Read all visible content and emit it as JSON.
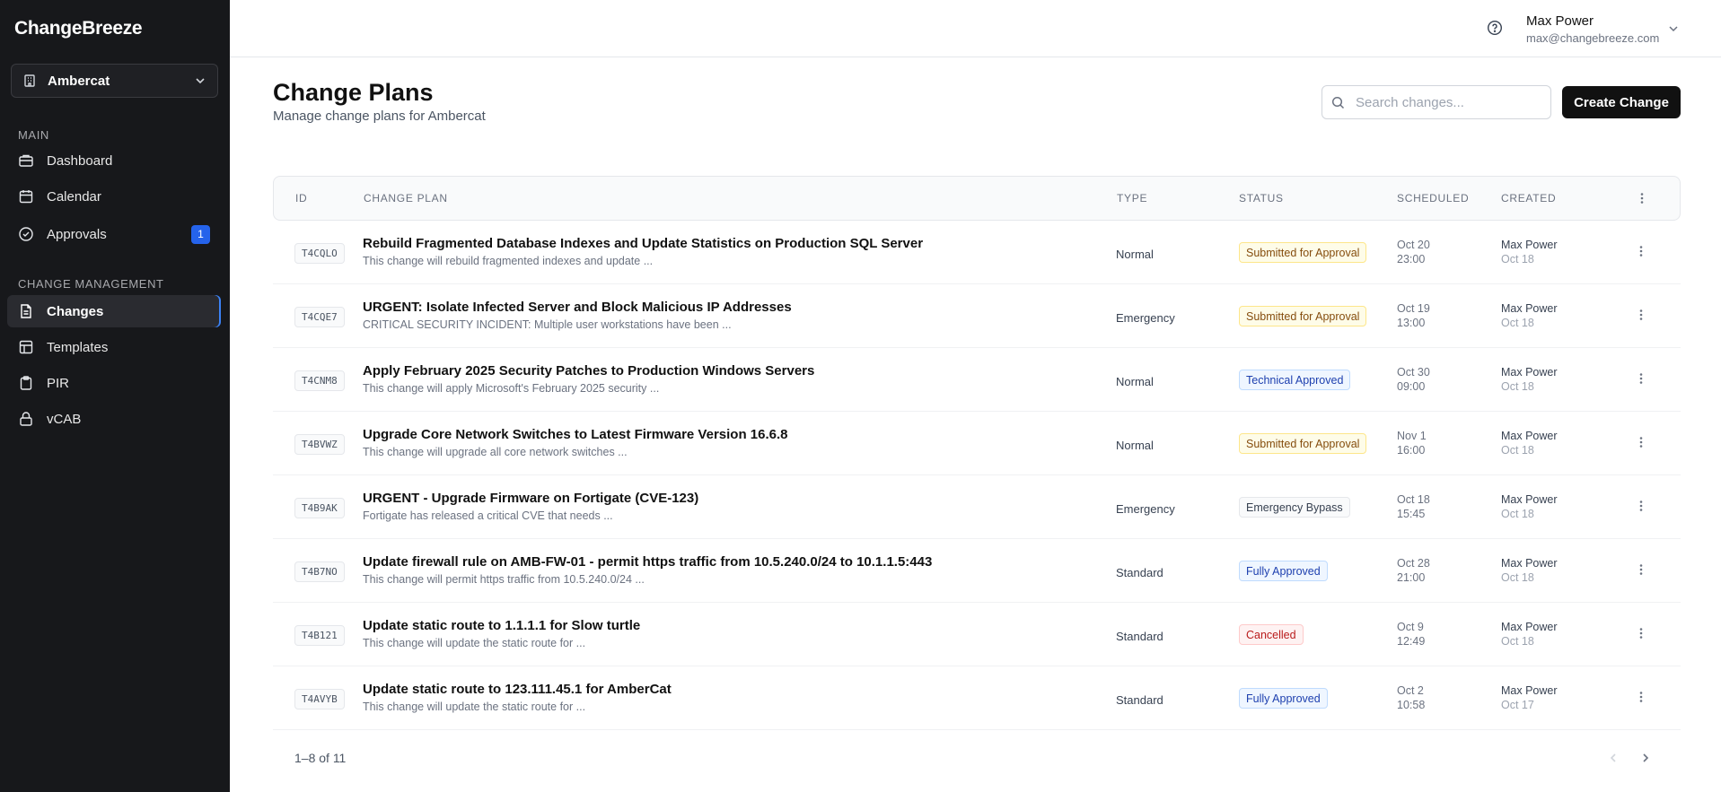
{
  "sidebar": {
    "brand": "ChangeBreeze",
    "org": "Ambercat",
    "sections": {
      "main": "MAIN",
      "change_management": "CHANGE MANAGEMENT"
    },
    "items": [
      {
        "label": "Dashboard",
        "icon": "briefcase-icon"
      },
      {
        "label": "Calendar",
        "icon": "calendar-icon"
      },
      {
        "label": "Approvals",
        "icon": "check-circle-icon",
        "badge": "1"
      },
      {
        "label": "Changes",
        "icon": "document-icon",
        "active": true
      },
      {
        "label": "Templates",
        "icon": "templates-icon"
      },
      {
        "label": "PIR",
        "icon": "clipboard-icon"
      },
      {
        "label": "vCAB",
        "icon": "lock-icon"
      }
    ]
  },
  "header": {
    "user_name": "Max Power",
    "user_email": "max@changebreeze.com"
  },
  "page": {
    "title": "Change Plans",
    "subtitle": "Manage change plans for Ambercat",
    "search_placeholder": "Search changes...",
    "create_label": "Create Change"
  },
  "table": {
    "headers": {
      "id": "ID",
      "plan": "CHANGE PLAN",
      "type": "TYPE",
      "status": "STATUS",
      "scheduled": "SCHEDULED",
      "created": "CREATED"
    },
    "rows": [
      {
        "id": "T4CQLO",
        "title": "Rebuild Fragmented Database Indexes and Update Statistics on Production SQL Server",
        "desc": "This change will rebuild fragmented indexes and update ...",
        "type": "Normal",
        "status": "Submitted for Approval",
        "sched_date": "Oct 20",
        "sched_time": "23:00",
        "created_by": "Max Power",
        "created_date": "Oct 18"
      },
      {
        "id": "T4CQE7",
        "title": "URGENT: Isolate Infected Server and Block Malicious IP Addresses",
        "desc": "CRITICAL SECURITY INCIDENT: Multiple user workstations have been ...",
        "type": "Emergency",
        "status": "Submitted for Approval",
        "sched_date": "Oct 19",
        "sched_time": "13:00",
        "created_by": "Max Power",
        "created_date": "Oct 18"
      },
      {
        "id": "T4CNM8",
        "title": "Apply February 2025 Security Patches to Production Windows Servers",
        "desc": "This change will apply Microsoft's February 2025 security ...",
        "type": "Normal",
        "status": "Technical Approved",
        "sched_date": "Oct 30",
        "sched_time": "09:00",
        "created_by": "Max Power",
        "created_date": "Oct 18"
      },
      {
        "id": "T4BVWZ",
        "title": "Upgrade Core Network Switches to Latest Firmware Version 16.6.8",
        "desc": "This change will upgrade all core network switches ...",
        "type": "Normal",
        "status": "Submitted for Approval",
        "sched_date": "Nov 1",
        "sched_time": "16:00",
        "created_by": "Max Power",
        "created_date": "Oct 18"
      },
      {
        "id": "T4B9AK",
        "title": "URGENT - Upgrade Firmware on Fortigate (CVE-123)",
        "desc": "Fortigate has released a critical CVE that needs ...",
        "type": "Emergency",
        "status": "Emergency Bypass",
        "sched_date": "Oct 18",
        "sched_time": "15:45",
        "created_by": "Max Power",
        "created_date": "Oct 18"
      },
      {
        "id": "T4B7NO",
        "title": "Update firewall rule on AMB-FW-01 - permit https traffic from 10.5.240.0/24 to 10.1.1.5:443",
        "desc": "This change will permit https traffic from 10.5.240.0/24 ...",
        "type": "Standard",
        "status": "Fully Approved",
        "sched_date": "Oct 28",
        "sched_time": "21:00",
        "created_by": "Max Power",
        "created_date": "Oct 18"
      },
      {
        "id": "T4B121",
        "title": "Update static route to 1.1.1.1 for Slow turtle",
        "desc": "This change will update the static route for ...",
        "type": "Standard",
        "status": "Cancelled",
        "sched_date": "Oct 9",
        "sched_time": "12:49",
        "created_by": "Max Power",
        "created_date": "Oct 18"
      },
      {
        "id": "T4AVYB",
        "title": "Update static route to 123.111.45.1 for AmberCat",
        "desc": "This change will update the static route for ...",
        "type": "Standard",
        "status": "Fully Approved",
        "sched_date": "Oct 2",
        "sched_time": "10:58",
        "created_by": "Max Power",
        "created_date": "Oct 17"
      }
    ],
    "pagination": "1–8 of 11"
  }
}
